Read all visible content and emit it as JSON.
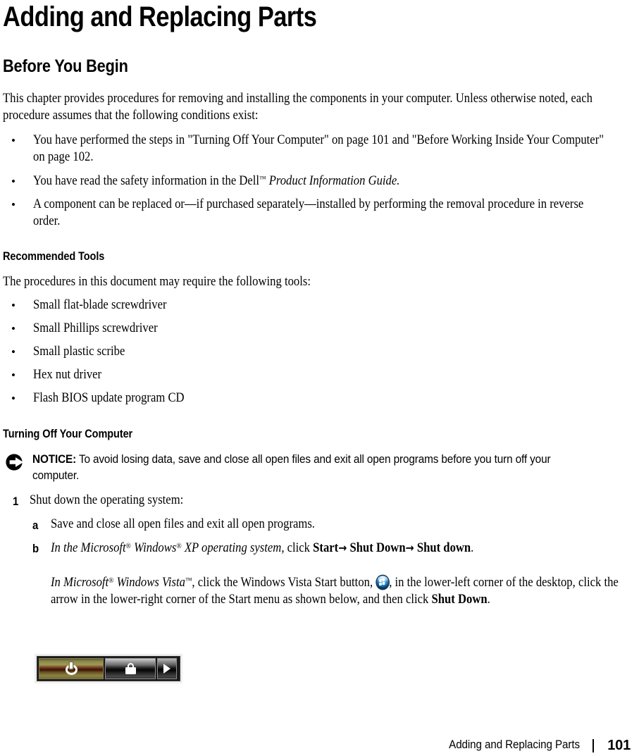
{
  "page": {
    "title": "Adding and Replacing Parts",
    "footer_title": "Adding and Replacing Parts",
    "footer_page_number": "101",
    "footer_separator": "|"
  },
  "sections": {
    "before_you_begin": {
      "heading": "Before You Begin",
      "intro": "This chapter provides procedures for removing and installing the components in your computer. Unless otherwise noted, each procedure assumes that the following conditions exist:",
      "bullets": [
        "You have performed the steps in \"Turning Off Your Computer\" on page 101 and \"Before Working Inside Your Computer\" on page 102.",
        "You have read the safety information in the Dell™ Product Information Guide.",
        "A component can be replaced or—if purchased separately—installed by performing the removal procedure in reverse order."
      ],
      "bullet_2_parts": {
        "lead": "You have read the safety information in the Dell",
        "tm": "™",
        "italic": "Product Information Guide",
        "tail": "."
      }
    },
    "recommended_tools": {
      "heading": "Recommended Tools",
      "intro": "The procedures in this document may require the following tools:",
      "tools": [
        "Small flat-blade screwdriver",
        "Small Phillips screwdriver",
        "Small plastic scribe",
        "Hex nut driver",
        "Flash BIOS update program CD"
      ]
    },
    "turning_off": {
      "heading": "Turning Off Your Computer",
      "notice": {
        "icon": "notice-arrow-icon",
        "label": "NOTICE:",
        "text": "To avoid losing data, save and close all open files and exit all open programs before you turn off your computer."
      },
      "steps": [
        {
          "marker": "1",
          "text": "Shut down the operating system:",
          "substeps": [
            {
              "marker": "a",
              "text": "Save and close all open files and exit all open programs."
            },
            {
              "marker": "b",
              "xp_line": {
                "italic_1": "In the Microsoft",
                "reg_1": "®",
                "italic_2": " Windows",
                "reg_2": "®",
                "italic_3": " XP operating system,",
                "plain": " click ",
                "bold_1": "Start",
                "arrow_1": "→",
                "bold_2": " Shut Down",
                "arrow_2": "→",
                "bold_3": " Shut down",
                "tail": "."
              },
              "vista_line": {
                "italic_1": "In Microsoft",
                "reg_1": "®",
                "italic_2": " Windows Vista",
                "tm_1": "™",
                "plain_1": ", click the Windows Vista Start button, ",
                "orb_icon": "windows-vista-start-orb-icon",
                "plain_2": ", in the lower-left corner of the desktop, click the arrow in the lower-right corner of the Start menu as shown below, and then click ",
                "bold_1": "Shut Down",
                "tail": "."
              }
            }
          ]
        }
      ],
      "power_bar": {
        "caption": "",
        "buttons": [
          {
            "name": "power-button",
            "icon": "power-icon"
          },
          {
            "name": "lock-button",
            "icon": "padlock-icon"
          },
          {
            "name": "more-options-button",
            "icon": "right-triangle-icon"
          }
        ]
      }
    }
  },
  "colors": {
    "text": "#000000",
    "background": "#ffffff",
    "power_button_amber": "#a09a55",
    "lock_button_dark": "#1a1a1a",
    "vista_orb_blue": "#1f7ec4"
  }
}
